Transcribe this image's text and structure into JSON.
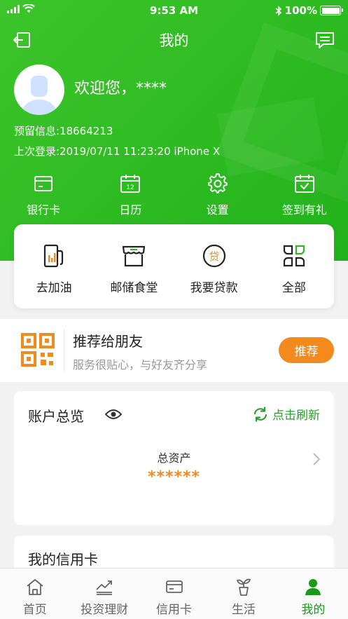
{
  "status_bar": {
    "time": "9:53 AM",
    "battery": "100%"
  },
  "header": {
    "title": "我的"
  },
  "profile": {
    "welcome": "欢迎您，****",
    "reserved_info": "预留信息:18664213",
    "last_login": "上次登录:2019/07/11  11:23:20  iPhone X"
  },
  "quick_actions": [
    {
      "label": "银行卡",
      "icon": "bank-card-icon"
    },
    {
      "label": "日历",
      "icon": "calendar-icon",
      "day": "12"
    },
    {
      "label": "设置",
      "icon": "gear-icon"
    },
    {
      "label": "签到有礼",
      "icon": "checkin-calendar-icon"
    }
  ],
  "services": [
    {
      "label": "去加油",
      "icon": "fuel-pump-icon"
    },
    {
      "label": "邮储食堂",
      "icon": "store-icon"
    },
    {
      "label": "我要贷款",
      "icon": "loan-icon",
      "glyph": "贷"
    },
    {
      "label": "全部",
      "icon": "grid-all-icon"
    }
  ],
  "recommend": {
    "title": "推荐给朋友",
    "subtitle": "服务很贴心，与好友齐分享",
    "button": "推荐"
  },
  "account": {
    "title": "账户总览",
    "refresh": "点击刷新",
    "asset_label": "总资产",
    "asset_value": "******"
  },
  "credit": {
    "title": "我的信用卡"
  },
  "tabs": [
    {
      "label": "首页",
      "icon": "home-icon",
      "active": false
    },
    {
      "label": "投资理财",
      "icon": "investment-icon",
      "active": false
    },
    {
      "label": "信用卡",
      "icon": "credit-card-icon",
      "active": false
    },
    {
      "label": "生活",
      "icon": "plant-icon",
      "active": false
    },
    {
      "label": "我的",
      "icon": "person-icon",
      "active": true
    }
  ],
  "colors": {
    "brand_green": "#2cb81f",
    "accent_orange": "#f28a1e",
    "active_tab": "#1a9a1a"
  }
}
